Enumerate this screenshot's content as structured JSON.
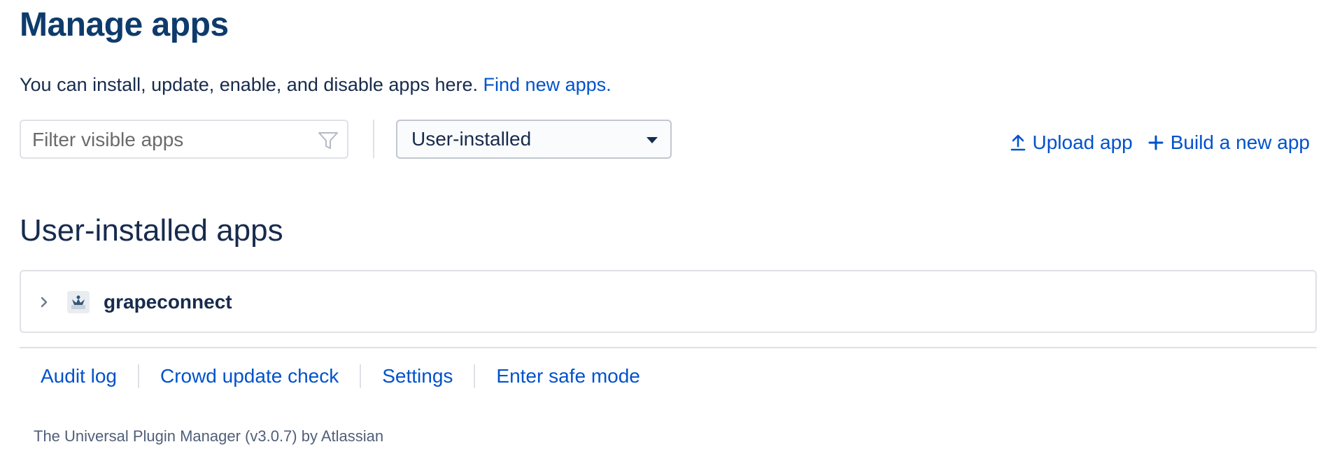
{
  "page": {
    "title": "Manage apps",
    "intro_text": "You can install, update, enable, and disable apps here.",
    "intro_link": "Find new apps."
  },
  "toolbar": {
    "filter": {
      "placeholder": "Filter visible apps",
      "value": "",
      "icon": "filter-icon"
    },
    "select": {
      "value": "User-installed",
      "icon": "caret-down-icon"
    },
    "actions": [
      {
        "label": "Upload app",
        "icon": "upload-icon"
      },
      {
        "label": "Build a new app",
        "icon": "plus-icon"
      }
    ]
  },
  "section": {
    "title": "User-installed apps",
    "apps": [
      {
        "name": "grapeconnect",
        "icon": "app-logo",
        "expand_icon": "chevron-right-icon"
      }
    ]
  },
  "footer": {
    "links": [
      "Audit log",
      "Crowd update check",
      "Settings",
      "Enter safe mode"
    ],
    "credit": "The Universal Plugin Manager (v3.0.7) by Atlassian"
  },
  "colors": {
    "title": "#0e3b6b",
    "text": "#172b4d",
    "link": "#0052cc",
    "border": "#dfe1e6",
    "muted": "#505f79"
  }
}
